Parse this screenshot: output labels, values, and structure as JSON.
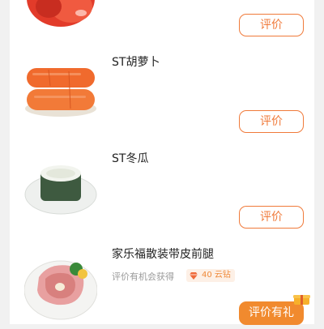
{
  "products": [
    {
      "name": "",
      "image": "tomato-image",
      "action_label": "评价"
    },
    {
      "name": "ST胡萝卜",
      "image": "carrot-image",
      "action_label": "评价"
    },
    {
      "name": "ST冬瓜",
      "image": "winter-melon-image",
      "action_label": "评价"
    },
    {
      "name": "家乐福散装带皮前腿",
      "image": "pork-leg-image",
      "hint": "评价有机会获得",
      "reward": "40 云钻",
      "reward_icon": "diamond-icon",
      "action_label": "评价有礼",
      "badge_icon": "gift-box-icon"
    }
  ],
  "colors": {
    "accent": "#f07a3a",
    "accent_fill": "#f18a2e",
    "reward_bg": "#fdf0e6",
    "background": "#f1f1f1"
  }
}
